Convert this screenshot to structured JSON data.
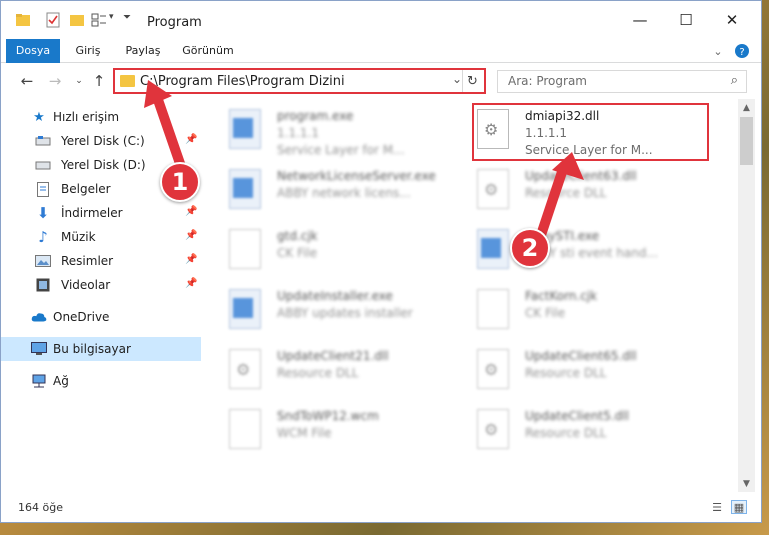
{
  "window": {
    "title": "Program"
  },
  "ribbon": {
    "tabs": [
      {
        "label": "Dosya",
        "active": true
      },
      {
        "label": "Giriş",
        "active": false
      },
      {
        "label": "Paylaş",
        "active": false
      },
      {
        "label": "Görünüm",
        "active": false
      }
    ]
  },
  "address": {
    "path": "C:\\Program Files\\Program Dizini"
  },
  "search": {
    "placeholder": "Ara: Program"
  },
  "sidebar": {
    "items": [
      {
        "label": "Hızlı erişim",
        "icon": "star-icon",
        "pinned": false
      },
      {
        "label": "Yerel Disk (C:)",
        "icon": "drive-icon",
        "pinned": true
      },
      {
        "label": "Yerel Disk (D:)",
        "icon": "drive-icon",
        "pinned": true
      },
      {
        "label": "Belgeler",
        "icon": "documents-icon",
        "pinned": true
      },
      {
        "label": "İndirmeler",
        "icon": "download-icon",
        "pinned": true
      },
      {
        "label": "Müzik",
        "icon": "music-icon",
        "pinned": true
      },
      {
        "label": "Resimler",
        "icon": "pictures-icon",
        "pinned": true
      },
      {
        "label": "Videolar",
        "icon": "video-icon",
        "pinned": true
      },
      {
        "label": "OneDrive",
        "icon": "cloud-icon",
        "pinned": false
      },
      {
        "label": "Bu bilgisayar",
        "icon": "computer-icon",
        "pinned": false,
        "selected": true
      },
      {
        "label": "Ağ",
        "icon": "network-icon",
        "pinned": false
      }
    ]
  },
  "files": [
    {
      "name": "program.exe",
      "sub1": "1.1.1.1",
      "sub2": "Service Layer for M...",
      "kind": "exe",
      "blurred": true
    },
    {
      "name": "dmiapi32.dll",
      "sub1": "1.1.1.1",
      "sub2": "Service Layer for M...",
      "kind": "dll",
      "blurred": false
    },
    {
      "name": "NetworkLicenseServer.exe",
      "sub1": "ABBY network licens...",
      "sub2": "",
      "kind": "app",
      "blurred": true
    },
    {
      "name": "UpdateClient63.dll",
      "sub1": "Resource DLL",
      "sub2": "",
      "kind": "dll",
      "blurred": true
    },
    {
      "name": "gtd.cjk",
      "sub1": "CK File",
      "sub2": "",
      "kind": "doc",
      "blurred": true
    },
    {
      "name": "AbbySTI.exe",
      "sub1": "ABBY sti event hand...",
      "sub2": "",
      "kind": "app",
      "blurred": true
    },
    {
      "name": "UpdateInstaller.exe",
      "sub1": "ABBY updates installer",
      "sub2": "",
      "kind": "app",
      "blurred": true
    },
    {
      "name": "FactKorn.cjk",
      "sub1": "CK File",
      "sub2": "",
      "kind": "doc",
      "blurred": true
    },
    {
      "name": "UpdateClient21.dll",
      "sub1": "Resource DLL",
      "sub2": "",
      "kind": "dll",
      "blurred": true
    },
    {
      "name": "UpdateClient65.dll",
      "sub1": "Resource DLL",
      "sub2": "",
      "kind": "dll",
      "blurred": true
    },
    {
      "name": "SndToWP12.wcm",
      "sub1": "WCM File",
      "sub2": "",
      "kind": "doc",
      "blurred": true
    },
    {
      "name": "UpdateClient5.dll",
      "sub1": "Resource DLL",
      "sub2": "",
      "kind": "dll",
      "blurred": true
    }
  ],
  "status": {
    "count": "164 öğe"
  },
  "annotations": {
    "step1": "1",
    "step2": "2",
    "color": "#e0343c"
  }
}
